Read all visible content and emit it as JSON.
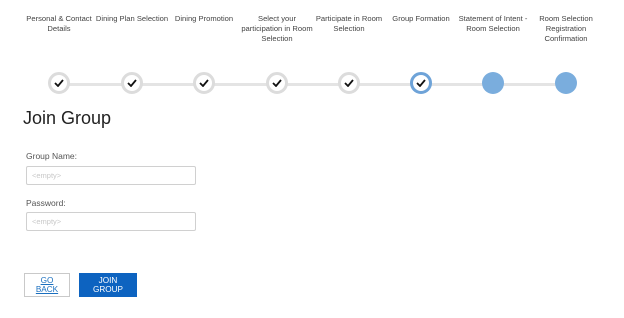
{
  "stepper": {
    "steps": [
      {
        "label": "Personal & Contact Details",
        "status": "done"
      },
      {
        "label": "Dining Plan Selection",
        "status": "done"
      },
      {
        "label": "Dining Promotion",
        "status": "done"
      },
      {
        "label": "Select your participation in Room Selection",
        "status": "done"
      },
      {
        "label": "Participate in Room Selection",
        "status": "done"
      },
      {
        "label": "Group Formation",
        "status": "current"
      },
      {
        "label": "Statement of Intent - Room Selection",
        "status": "todo"
      },
      {
        "label": "Room Selection Registration Confirmation",
        "status": "todo"
      }
    ],
    "colors": {
      "completed_border": "#dcdcdc",
      "current_border": "#6ea3d8",
      "upcoming_fill": "#7aaddd",
      "track": "#e4e4e4"
    }
  },
  "form": {
    "title": "Join Group",
    "group_name": {
      "label": "Group Name:",
      "value": "",
      "placeholder": "<empty>"
    },
    "password": {
      "label": "Password:",
      "value": "",
      "placeholder": "<empty>"
    }
  },
  "actions": {
    "back_label": "GO BACK",
    "join_label": "JOIN GROUP",
    "primary_color": "#0d63c0"
  }
}
